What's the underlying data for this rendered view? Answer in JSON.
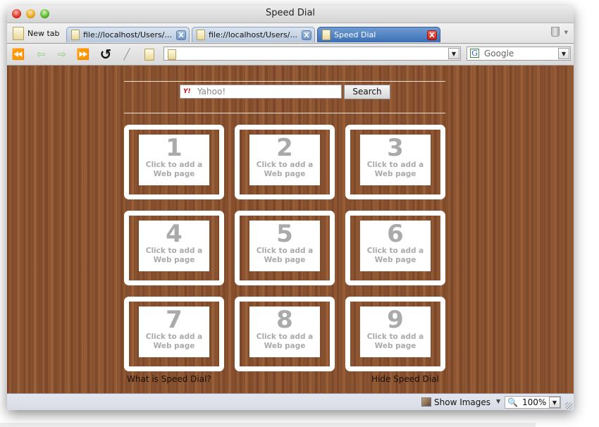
{
  "window": {
    "title": "Speed Dial"
  },
  "tabs": {
    "new_tab_label": "New tab",
    "items": [
      {
        "label": "file://localhost/Users/...",
        "close": "X",
        "active": false
      },
      {
        "label": "file://localhost/Users/...",
        "close": "X",
        "active": false
      },
      {
        "label": "Speed Dial",
        "close": "X",
        "active": true
      }
    ]
  },
  "toolbar": {
    "icons": [
      "rewind-icon",
      "back-icon",
      "forward-icon",
      "fast-forward-icon",
      "reload-icon",
      "edit-icon",
      "go-icon"
    ],
    "url": "",
    "search_engine": "Google"
  },
  "page": {
    "search": {
      "engine": "Yahoo!",
      "button": "Search"
    },
    "dials": [
      {
        "number": "1",
        "text": "Click to add a Web page"
      },
      {
        "number": "2",
        "text": "Click to add a Web page"
      },
      {
        "number": "3",
        "text": "Click to add a Web page"
      },
      {
        "number": "4",
        "text": "Click to add a Web page"
      },
      {
        "number": "5",
        "text": "Click to add a Web page"
      },
      {
        "number": "6",
        "text": "Click to add a Web page"
      },
      {
        "number": "7",
        "text": "Click to add a Web page"
      },
      {
        "number": "8",
        "text": "Click to add a Web page"
      },
      {
        "number": "9",
        "text": "Click to add a Web page"
      }
    ],
    "links": {
      "about": "What is Speed Dial?",
      "hide": "Hide Speed Dial"
    }
  },
  "statusbar": {
    "show_images": "Show Images",
    "zoom": "100%"
  }
}
